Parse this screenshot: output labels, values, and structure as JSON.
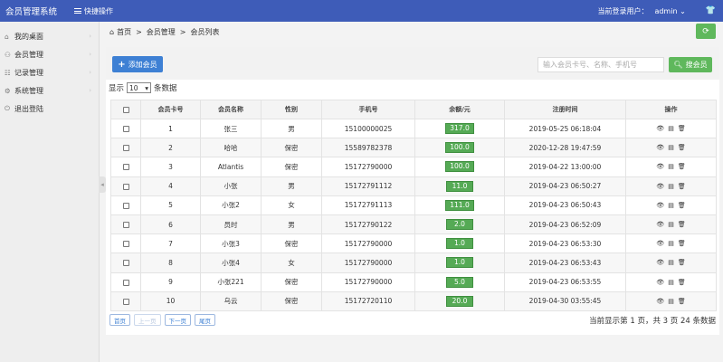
{
  "app": {
    "title": "会员管理系统"
  },
  "topbar": {
    "quick_ops": "快捷操作",
    "login_label": "当前登录用户：",
    "user": "admin"
  },
  "sidebar": {
    "items": [
      {
        "icon": "home-icon",
        "glyph": "⌂",
        "label": "我的桌面"
      },
      {
        "icon": "user-icon",
        "glyph": "⚇",
        "label": "会员管理"
      },
      {
        "icon": "record-icon",
        "glyph": "☷",
        "label": "记录管理"
      },
      {
        "icon": "settings-icon",
        "glyph": "⚙",
        "label": "系统管理"
      },
      {
        "icon": "logout-icon",
        "glyph": "⏻",
        "label": "退出登陆"
      }
    ]
  },
  "breadcrumb": {
    "items": [
      "首页",
      "会员管理",
      "会员列表"
    ],
    "sep": ">"
  },
  "toolbar": {
    "add_label": "添加会员",
    "search_placeholder": "输入会员卡号、名称、手机号",
    "search_label": "搜会员"
  },
  "pagesize": {
    "prefix": "显示",
    "value": "10",
    "suffix": "条数据"
  },
  "table": {
    "columns": [
      "会员卡号",
      "会员名称",
      "性别",
      "手机号",
      "余额/元",
      "注册时间",
      "操作"
    ],
    "rows": [
      {
        "id": "1",
        "name": "张三",
        "gender": "男",
        "phone": "15100000025",
        "balance": "317.0",
        "time": "2019-05-25 06:18:04"
      },
      {
        "id": "2",
        "name": "哈哈",
        "gender": "保密",
        "phone": "15589782378",
        "balance": "100.0",
        "time": "2020-12-28 19:47:59"
      },
      {
        "id": "3",
        "name": "Atlantis",
        "gender": "保密",
        "phone": "15172790000",
        "balance": "100.0",
        "time": "2019-04-22 13:00:00"
      },
      {
        "id": "4",
        "name": "小张",
        "gender": "男",
        "phone": "15172791112",
        "balance": "11.0",
        "time": "2019-04-23 06:50:27"
      },
      {
        "id": "5",
        "name": "小张2",
        "gender": "女",
        "phone": "15172791113",
        "balance": "111.0",
        "time": "2019-04-23 06:50:43"
      },
      {
        "id": "6",
        "name": "员时",
        "gender": "男",
        "phone": "15172790122",
        "balance": "2.0",
        "time": "2019-04-23 06:52:09"
      },
      {
        "id": "7",
        "name": "小张3",
        "gender": "保密",
        "phone": "15172790000",
        "balance": "1.0",
        "time": "2019-04-23 06:53:30"
      },
      {
        "id": "8",
        "name": "小张4",
        "gender": "女",
        "phone": "15172790000",
        "balance": "1.0",
        "time": "2019-04-23 06:53:43"
      },
      {
        "id": "9",
        "name": "小张221",
        "gender": "保密",
        "phone": "15172790000",
        "balance": "5.0",
        "time": "2019-04-23 06:53:55"
      },
      {
        "id": "10",
        "name": "乌云",
        "gender": "保密",
        "phone": "15172720110",
        "balance": "20.0",
        "time": "2019-04-30 03:55:45"
      }
    ]
  },
  "pager": {
    "first": "首页",
    "prev": "上一页",
    "next": "下一页",
    "last": "尾页"
  },
  "pageinfo": "当前显示第 1 页，共 3 页 24 条数据",
  "colors": {
    "topbar": "#3e5cb8",
    "primary": "#3e80d4",
    "success": "#5fb85c",
    "balance": "#55aa55"
  }
}
